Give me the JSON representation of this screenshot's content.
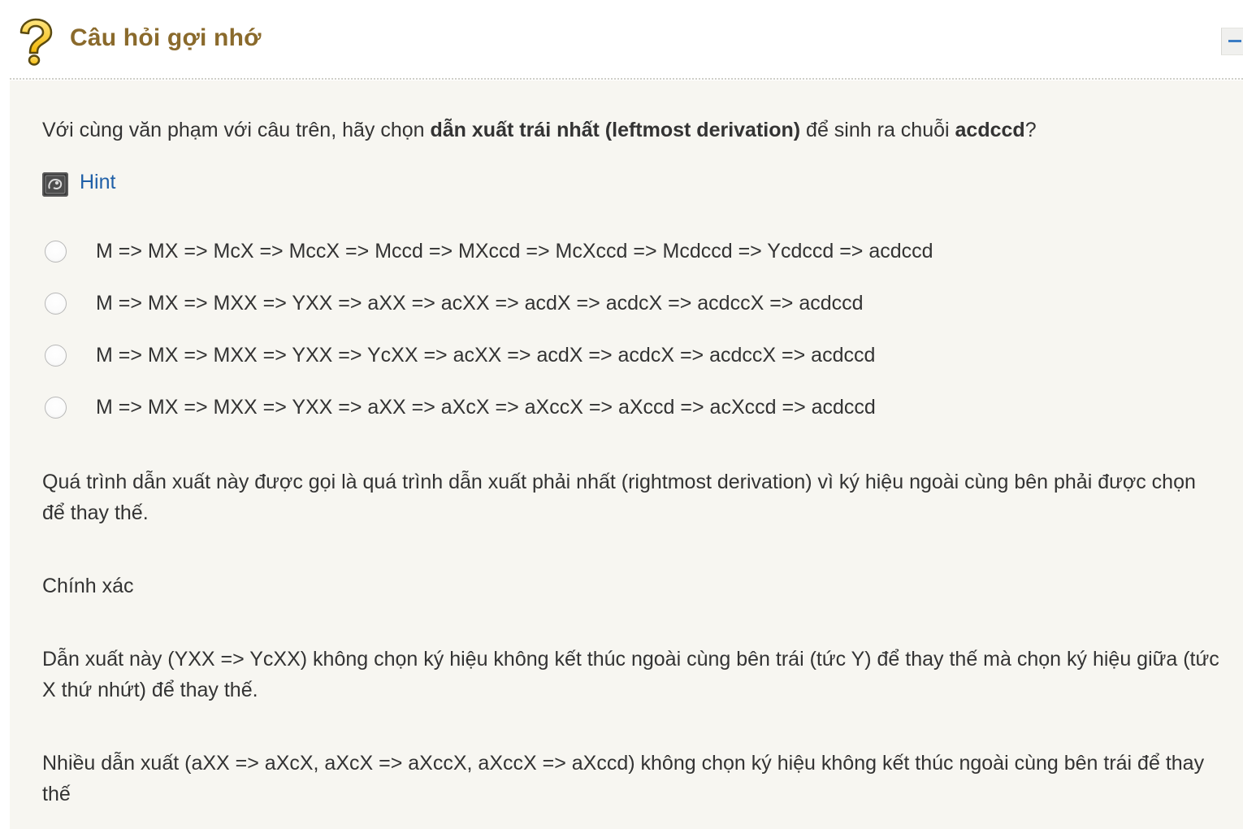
{
  "header": {
    "title": "Câu hỏi gợi nhớ",
    "icon": "question-mark-icon",
    "collapse_icon": "minus-icon"
  },
  "question": {
    "prefix": "Với cùng văn phạm với câu trên, hãy chọn ",
    "bold1": "dẫn xuất trái nhất (leftmost derivation)",
    "middle": " để sinh ra chuỗi ",
    "bold2": "acdccd",
    "suffix": "?"
  },
  "hint": {
    "label": "Hint",
    "icon": "hint-icon"
  },
  "options": [
    {
      "text": "M => MX => McX => MccX => Mccd => MXccd => McXccd => Mcdccd => Ycdccd => acdccd",
      "selected": false
    },
    {
      "text": "M => MX => MXX => YXX => aXX => acXX => acdX => acdcX => acdccX => acdccd",
      "selected": false
    },
    {
      "text": "M => MX => MXX => YXX => YcXX => acXX => acdX => acdcX => acdccX => acdccd",
      "selected": false
    },
    {
      "text": "M => MX => MXX => YXX => aXX => aXcX => aXccX => aXccd => acXccd => acdccd",
      "selected": false
    }
  ],
  "feedback": {
    "f1": "Quá trình dẫn xuất này được gọi là quá trình dẫn xuất phải nhất (rightmost derivation) vì ký hiệu ngoài cùng bên phải được chọn để thay thế.",
    "f2": "Chính xác",
    "f3": "Dẫn xuất này (YXX => YcXX) không chọn ký hiệu không kết thúc ngoài cùng bên trái (tức Y) để thay thế mà chọn ký hiệu giữa (tức X thứ nhứt) để thay thế.",
    "f4": "Nhiều dẫn xuất (aXX => aXcX, aXcX => aXccX, aXccX => aXccd) không chọn ký hiệu không kết thúc ngoài cùng bên trái để thay thế"
  },
  "colors": {
    "title": "#8a6a2c",
    "panel_bg": "#f7f6f1",
    "link": "#2060a8",
    "collapse_accent": "#3b7cc4"
  }
}
